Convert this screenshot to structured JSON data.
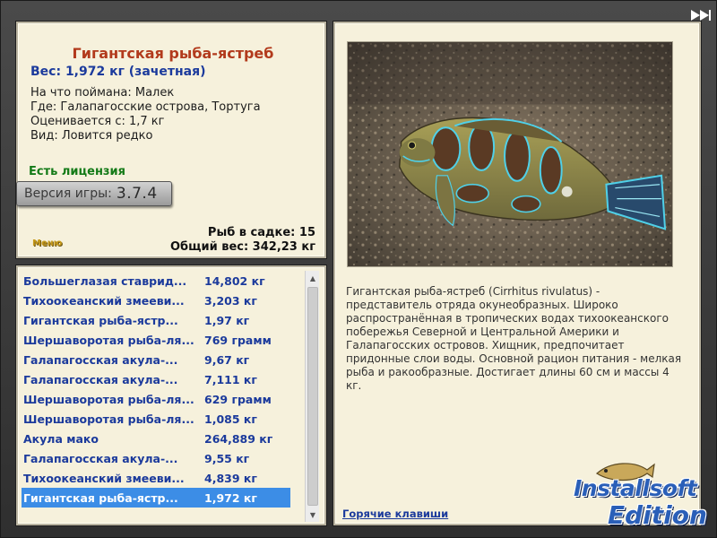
{
  "info": {
    "title": "Гигантская рыба-ястреб",
    "weight": "Вес: 1,972 кг (зачетная)",
    "bait": "На что поймана: Малек",
    "where": "Где: Галапагосские острова, Тортуга",
    "value": "Оценивается с: 1,7 кг",
    "kind": "Вид: Ловится редко",
    "license": "Есть лицензия",
    "version_label": "Версия игры:",
    "version_number": "3.7.4",
    "menu": "Меню",
    "cage_count": "Рыб в садке: 15",
    "total_weight": "Общий вес: 342,23 кг"
  },
  "catches": [
    {
      "name": "Большеглазая ставрид...",
      "weight": "14,802 кг"
    },
    {
      "name": "Тихоокеанский змееви...",
      "weight": "3,203 кг"
    },
    {
      "name": "Гигантская рыба-ястр...",
      "weight": "1,97 кг"
    },
    {
      "name": "Шершаворотая рыба-ля...",
      "weight": "769 грамм"
    },
    {
      "name": "Галапагосская акула-...",
      "weight": "9,67 кг"
    },
    {
      "name": "Галапагосская акула-...",
      "weight": "7,111 кг"
    },
    {
      "name": "Шершаворотая рыба-ля...",
      "weight": "629 грамм"
    },
    {
      "name": "Шершаворотая рыба-ля...",
      "weight": "1,085 кг"
    },
    {
      "name": "Акула мако",
      "weight": "264,889 кг"
    },
    {
      "name": "Галапагосская акула-...",
      "weight": "9,55 кг"
    },
    {
      "name": "Тихоокеанский змееви...",
      "weight": "4,839 кг"
    },
    {
      "name": "Гигантская рыба-ястр...",
      "weight": "1,972 кг"
    }
  ],
  "selected_index": 11,
  "detail": {
    "description": "Гигантская рыба-ястреб (Cirrhitus rivulatus) - представитель отряда окунеобразных. Широко распространённая в тропических водах тихоокеанского побережья Северной и Центральной Америки и Галапагосских островов. Хищник, предпочитает придонные слои воды. Основной рацион питания - мелкая рыба и ракообразные. Достигает длины 60 см и массы 4 кг.",
    "hotkeys": "Горячие клавиши"
  },
  "logo": {
    "line1": "Installsoft",
    "line2": "Edition"
  },
  "icons": {
    "fast_forward": "fast-forward-icon",
    "scroll_up": "triangle-up",
    "scroll_down": "triangle-down"
  },
  "colors": {
    "title": "#b23a1c",
    "accent_blue": "#1b3a9c",
    "license_green": "#137a17",
    "selection": "#3c8de6",
    "panel_bg": "#f6f1dc"
  }
}
